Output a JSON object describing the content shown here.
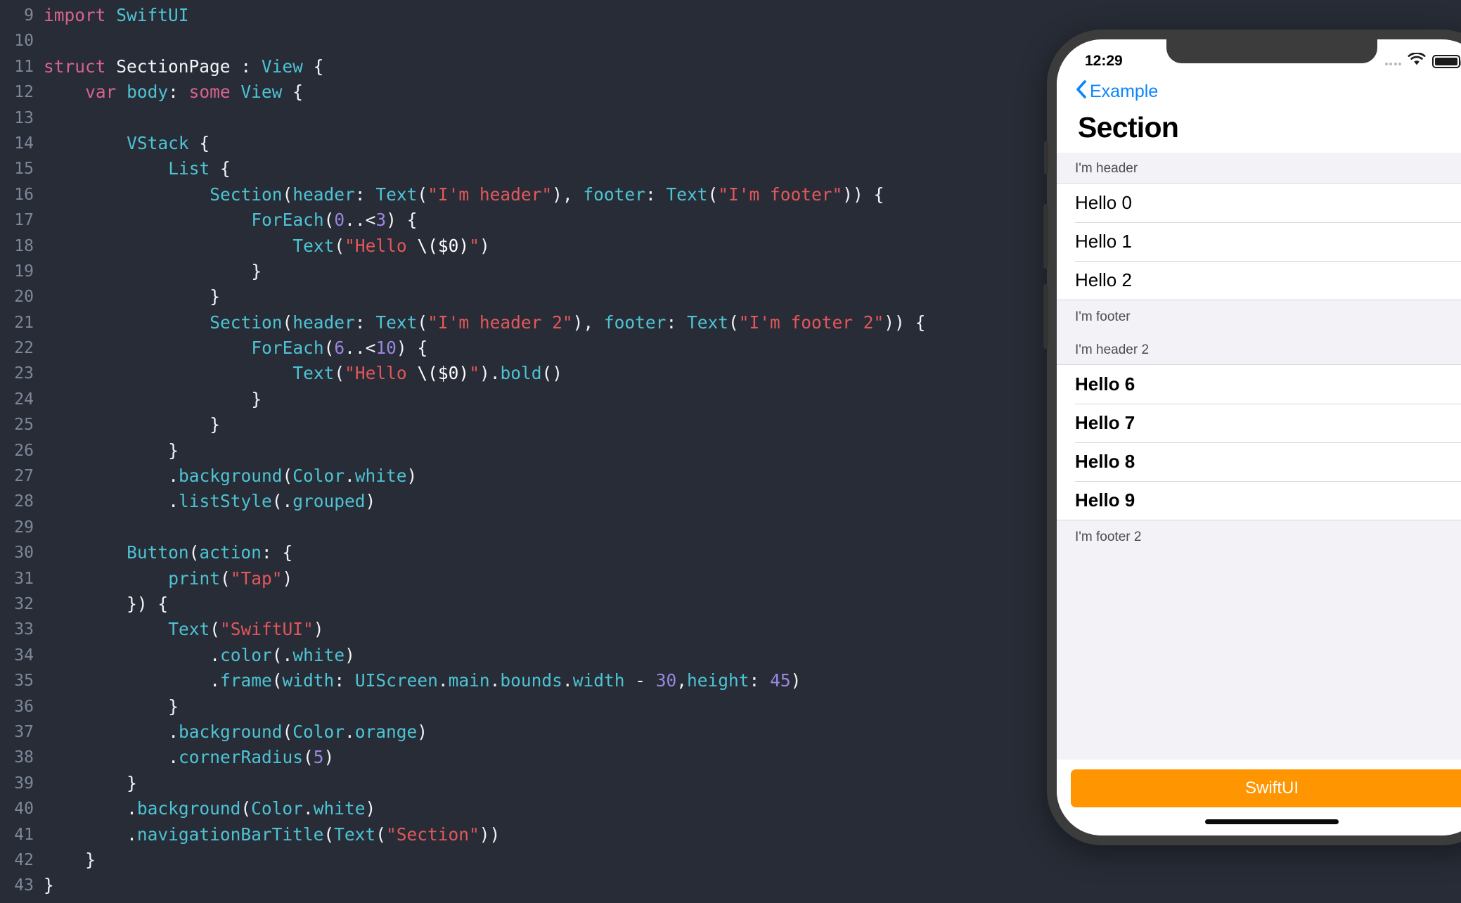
{
  "editor": {
    "first_line_number": 9,
    "lines": [
      {
        "n": 9,
        "text": "import SwiftUI"
      },
      {
        "n": 10,
        "text": ""
      },
      {
        "n": 11,
        "text": "struct SectionPage : View {"
      },
      {
        "n": 12,
        "text": "    var body: some View {"
      },
      {
        "n": 13,
        "text": ""
      },
      {
        "n": 14,
        "text": "        VStack {"
      },
      {
        "n": 15,
        "text": "            List {"
      },
      {
        "n": 16,
        "text": "                Section(header: Text(\"I'm header\"), footer: Text(\"I'm footer\")) {"
      },
      {
        "n": 17,
        "text": "                    ForEach(0..<3) {"
      },
      {
        "n": 18,
        "text": "                        Text(\"Hello \\($0)\")"
      },
      {
        "n": 19,
        "text": "                    }"
      },
      {
        "n": 20,
        "text": "                }"
      },
      {
        "n": 21,
        "text": "                Section(header: Text(\"I'm header 2\"), footer: Text(\"I'm footer 2\")) {"
      },
      {
        "n": 22,
        "text": "                    ForEach(6..<10) {"
      },
      {
        "n": 23,
        "text": "                        Text(\"Hello \\($0)\").bold()"
      },
      {
        "n": 24,
        "text": "                    }"
      },
      {
        "n": 25,
        "text": "                }"
      },
      {
        "n": 26,
        "text": "            }"
      },
      {
        "n": 27,
        "text": "            .background(Color.white)"
      },
      {
        "n": 28,
        "text": "            .listStyle(.grouped)"
      },
      {
        "n": 29,
        "text": ""
      },
      {
        "n": 30,
        "text": "        Button(action: {"
      },
      {
        "n": 31,
        "text": "            print(\"Tap\")"
      },
      {
        "n": 32,
        "text": "        }) {"
      },
      {
        "n": 33,
        "text": "            Text(\"SwiftUI\")"
      },
      {
        "n": 34,
        "text": "                .color(.white)"
      },
      {
        "n": 35,
        "text": "                .frame(width: UIScreen.main.bounds.width - 30,height: 45)"
      },
      {
        "n": 36,
        "text": "            }"
      },
      {
        "n": 37,
        "text": "            .background(Color.orange)"
      },
      {
        "n": 38,
        "text": "            .cornerRadius(5)"
      },
      {
        "n": 39,
        "text": "        }"
      },
      {
        "n": 40,
        "text": "        .background(Color.white)"
      },
      {
        "n": 41,
        "text": "        .navigationBarTitle(Text(\"Section\"))"
      },
      {
        "n": 42,
        "text": "    }"
      },
      {
        "n": 43,
        "text": "}"
      }
    ],
    "colors": {
      "background": "#272c36",
      "gutter_text": "#7f8899",
      "keyword": "#d8638f",
      "type": "#4ec3d4",
      "string": "#e3575a",
      "number": "#9b87e0",
      "plain": "#f2f4f7"
    }
  },
  "phone": {
    "status_bar": {
      "time": "12:29",
      "signal_icon": "signal-dots-icon",
      "wifi_icon": "wifi-icon",
      "battery_icon": "battery-full-icon"
    },
    "nav": {
      "back_icon": "chevron-left-icon",
      "back_label": "Example",
      "title": "Section",
      "tint_color": "#0a84ff"
    },
    "list": {
      "sections": [
        {
          "header": "I'm header",
          "footer": "I'm footer",
          "bold_rows": false,
          "rows": [
            "Hello 0",
            "Hello 1",
            "Hello 2"
          ]
        },
        {
          "header": "I'm header 2",
          "footer": "I'm footer 2",
          "bold_rows": true,
          "rows": [
            "Hello 6",
            "Hello 7",
            "Hello 8",
            "Hello 9"
          ]
        }
      ]
    },
    "bottom_button": {
      "label": "SwiftUI",
      "background_color": "#ff9500",
      "text_color": "#ffffff"
    },
    "home_indicator": "home-indicator"
  }
}
